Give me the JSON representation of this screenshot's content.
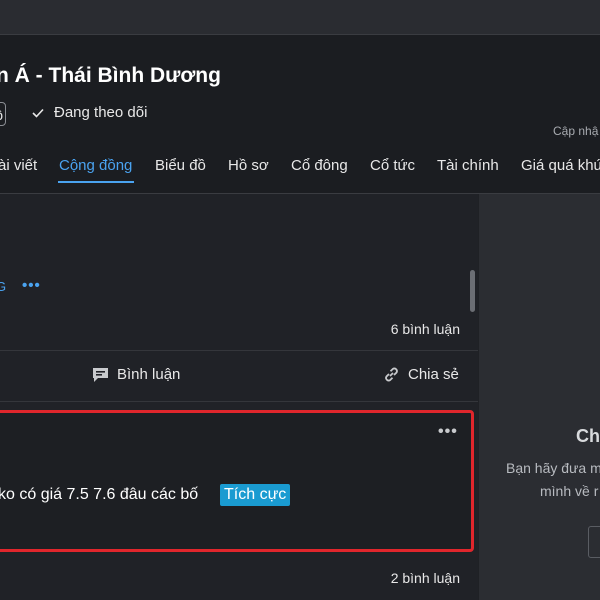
{
  "header": {
    "title": "n Á - Thái Bình Dương",
    "badge_fragment": "ô",
    "follow_label": "Đang theo dõi",
    "update_fragment": "Cập nhậ"
  },
  "tabs": [
    {
      "label": "ài viết"
    },
    {
      "label": "Cộng đồng",
      "active": true
    },
    {
      "label": "Biểu đồ"
    },
    {
      "label": "Hồ sơ"
    },
    {
      "label": "Cổ đông"
    },
    {
      "label": "Cổ tức"
    },
    {
      "label": "Tài chính"
    },
    {
      "label": "Giá quá khứ"
    }
  ],
  "feed": {
    "post1": {
      "tag_fragment": "G",
      "more_label": "•••",
      "comment_count": "6 bình luận",
      "comment_action": "Bình luận",
      "share_action": "Chia sẻ"
    },
    "post2": {
      "more_label": "•••",
      "text": "ko có giá 7.5 7.6 đâu các bố",
      "sentiment": "Tích cực",
      "comment_count": "2 bình luận"
    }
  },
  "sidebar": {
    "title_fragment": "Ch",
    "line1": "Bạn hãy đưa m",
    "line2": "mình về r"
  },
  "colors": {
    "accent": "#4aa3f0",
    "highlight_border": "#e0262c",
    "sentiment_bg": "#1a9bd1"
  }
}
